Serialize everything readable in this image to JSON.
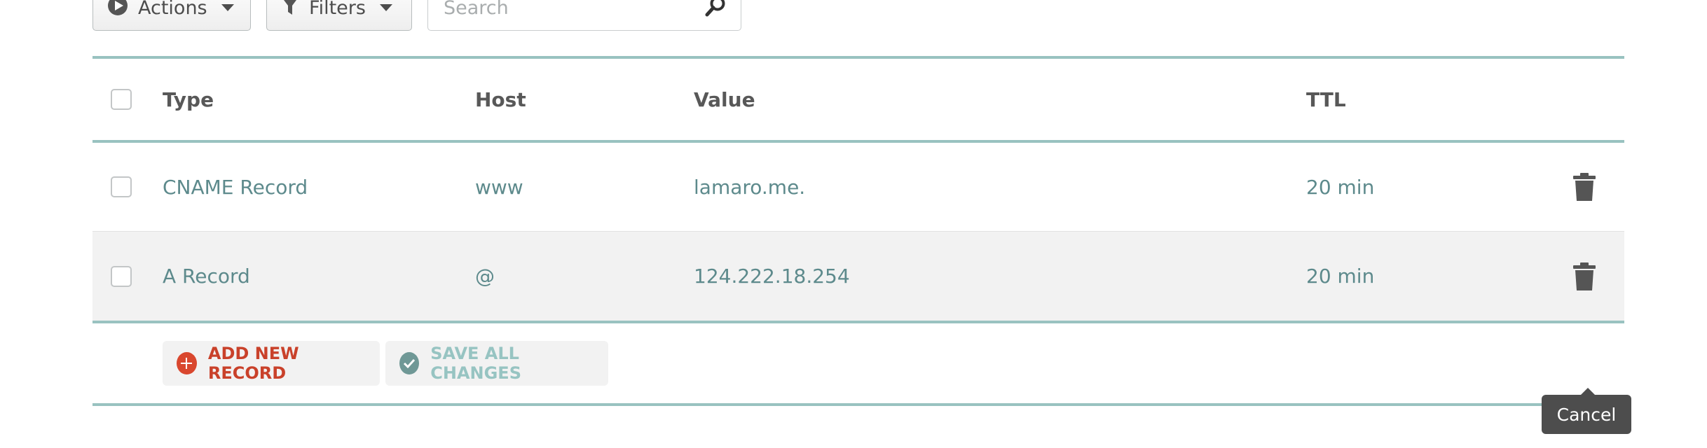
{
  "toolbar": {
    "actions_label": "Actions",
    "filters_label": "Filters",
    "search_placeholder": "Search"
  },
  "table": {
    "columns": {
      "type": "Type",
      "host": "Host",
      "value": "Value",
      "ttl": "TTL"
    },
    "rows": [
      {
        "type": "CNAME Record",
        "host": "www",
        "value": "lamaro.me.",
        "ttl": "20 min"
      },
      {
        "type": "A Record",
        "host": "@",
        "value": "124.222.18.254",
        "ttl": "20 min"
      }
    ]
  },
  "footer": {
    "add_label": "ADD NEW RECORD",
    "save_label": "SAVE ALL CHANGES"
  },
  "tooltip": {
    "cancel_label": "Cancel"
  },
  "colors": {
    "accent_teal": "#99c2c0",
    "record_text": "#5d8a8c",
    "add_red": "#c9412a",
    "save_teal": "#97c4c2"
  },
  "icons": [
    "play-circle-icon",
    "funnel-icon",
    "search-icon",
    "trash-icon",
    "plus-circle-icon",
    "check-circle-icon"
  ]
}
